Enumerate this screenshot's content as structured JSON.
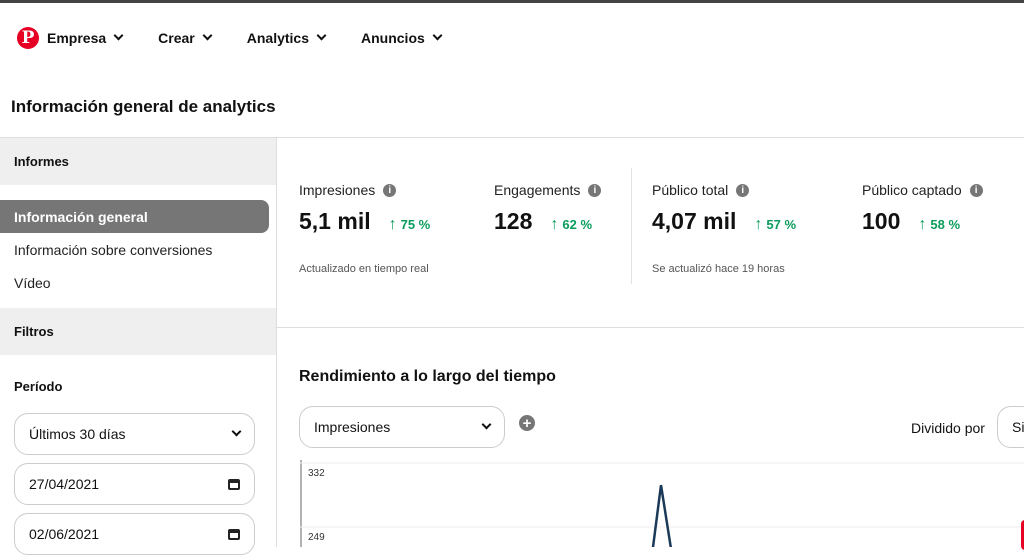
{
  "nav": {
    "items": [
      {
        "label": "Empresa"
      },
      {
        "label": "Crear"
      },
      {
        "label": "Analytics"
      },
      {
        "label": "Anuncios"
      }
    ],
    "logo_letter": "P"
  },
  "page_title": "Información general de analytics",
  "sidebar": {
    "reports_header": "Informes",
    "items": [
      {
        "label": "Información general",
        "selected": true
      },
      {
        "label": "Información sobre conversiones"
      },
      {
        "label": "Vídeo"
      }
    ],
    "filters_header": "Filtros",
    "period_label": "Período",
    "period_value": "Últimos 30 días",
    "start_date": "27/04/2021",
    "end_date": "02/06/2021"
  },
  "metrics": [
    {
      "label": "Impresiones",
      "value": "5,1 mil",
      "delta": "75 %"
    },
    {
      "label": "Engagements",
      "value": "128",
      "delta": "62 %"
    },
    {
      "label": "Público total",
      "value": "4,07 mil",
      "delta": "57 %"
    },
    {
      "label": "Público captado",
      "value": "100",
      "delta": "58 %"
    }
  ],
  "notes": {
    "realtime": "Actualizado en tiempo real",
    "updated": "Se actualizó hace 19 horas"
  },
  "performance": {
    "title": "Rendimiento a lo largo del tiempo",
    "metric_select": "Impresiones",
    "split_label": "Dividido por",
    "split_value": "Si",
    "y_ticks": [
      "332",
      "249"
    ],
    "line_color": "#1b3a57",
    "peak_value": 315
  },
  "colors": {
    "accent": "#e60023",
    "positive": "#0a9c5c",
    "selected": "#767676"
  }
}
